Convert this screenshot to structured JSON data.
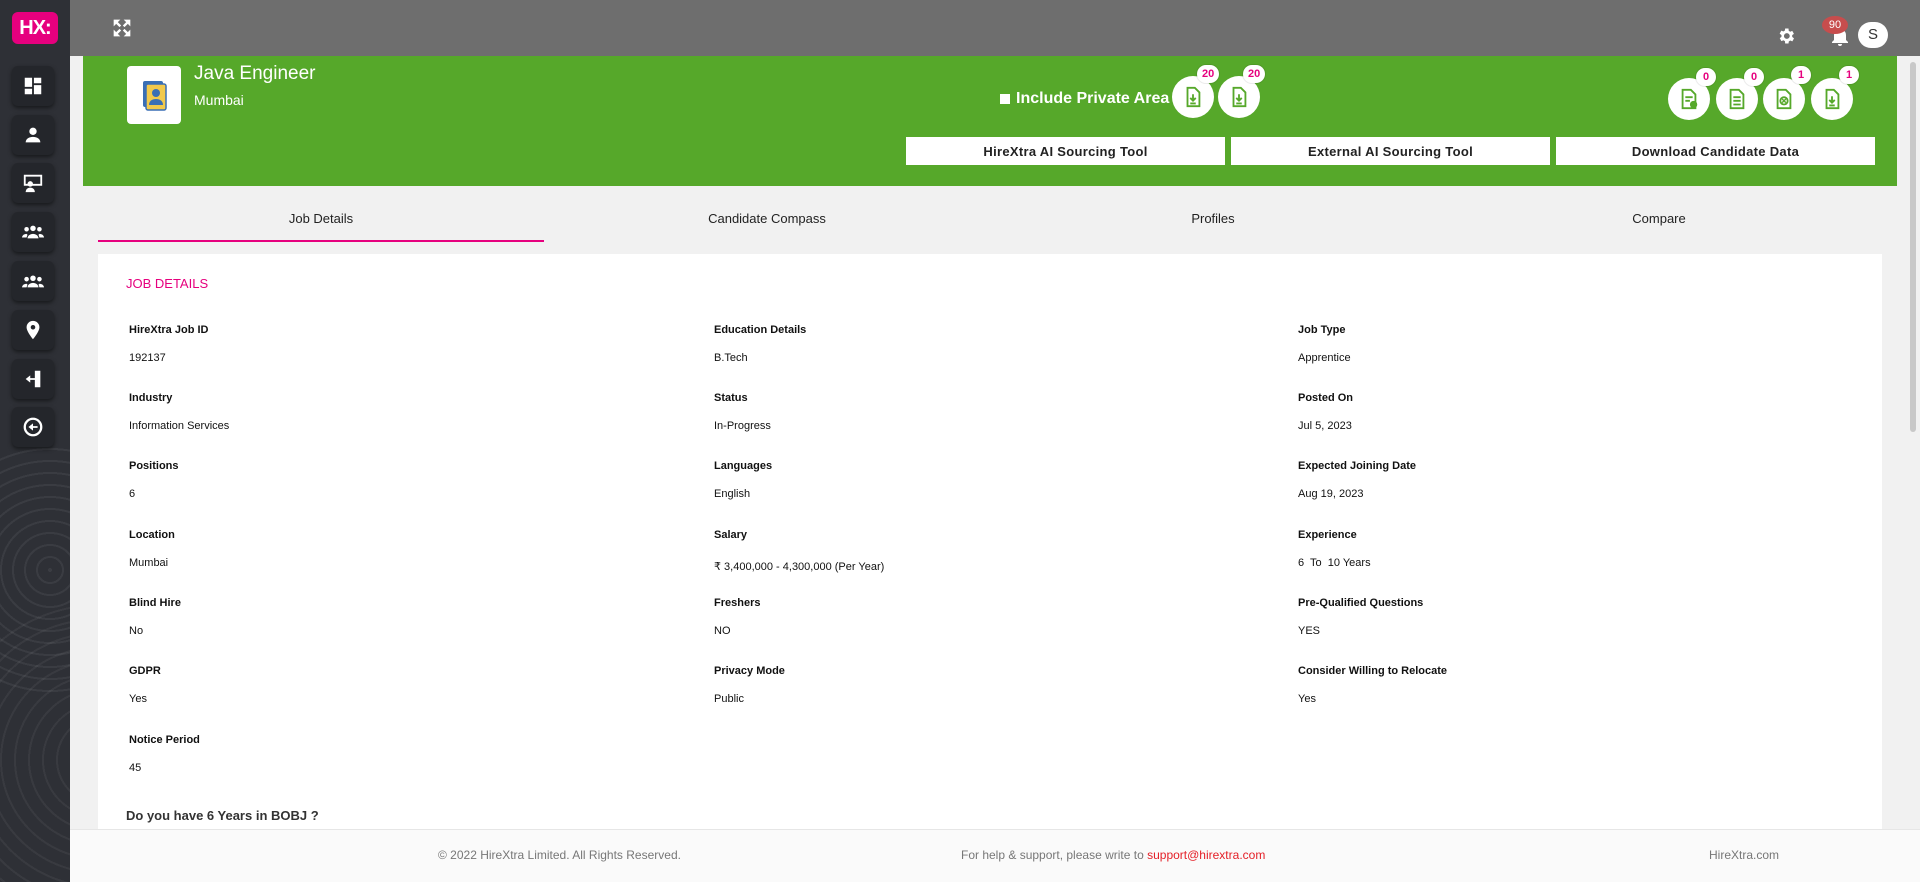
{
  "brand": {
    "logo_text": "HX:",
    "accent": "#e6007e",
    "green": "#56a82a"
  },
  "sidebar": {
    "items": [
      {
        "name": "dashboard-icon"
      },
      {
        "name": "user-icon"
      },
      {
        "name": "presentation-icon"
      },
      {
        "name": "team-icon"
      },
      {
        "name": "group-icon"
      },
      {
        "name": "location-pin-icon"
      },
      {
        "name": "logout-icon"
      },
      {
        "name": "back-arrow-icon"
      }
    ]
  },
  "topbar": {
    "notifications_count": "90",
    "avatar_initial": "S"
  },
  "job": {
    "title": "Java Engineer",
    "location": "Mumbai",
    "include_private_label": "Include Private Area",
    "left_badges": [
      "20",
      "20"
    ],
    "right_badges": [
      "0",
      "0",
      "1",
      "1"
    ],
    "buttons": [
      "HireXtra AI Sourcing Tool",
      "External AI Sourcing Tool",
      "Download Candidate Data"
    ]
  },
  "tabs": [
    "Job Details",
    "Candidate Compass",
    "Profiles",
    "Compare"
  ],
  "details": {
    "section_title": "JOB DETAILS",
    "rows": [
      [
        {
          "label": "HireXtra Job ID",
          "value": "192137"
        },
        {
          "label": "Education Details",
          "value": "B.Tech"
        },
        {
          "label": "Job Type",
          "value": "Apprentice"
        }
      ],
      [
        {
          "label": "Industry",
          "value": "Information Services"
        },
        {
          "label": "Status",
          "value": "In-Progress"
        },
        {
          "label": "Posted On",
          "value": "Jul 5, 2023"
        }
      ],
      [
        {
          "label": "Positions",
          "value": "6"
        },
        {
          "label": "Languages",
          "value": "English"
        },
        {
          "label": "Expected Joining Date",
          "value": "Aug 19, 2023"
        }
      ],
      [
        {
          "label": "Location",
          "value": "Mumbai"
        },
        {
          "label": "Salary",
          "value": "₹ 3,400,000 - 4,300,000 (Per Year)"
        },
        {
          "label": "Experience",
          "value": "6  To  10 Years"
        }
      ],
      [
        {
          "label": "Blind Hire",
          "value": "No"
        },
        {
          "label": "Freshers",
          "value": "NO"
        },
        {
          "label": "Pre-Qualified Questions",
          "value": "YES"
        }
      ],
      [
        {
          "label": "GDPR",
          "value": "Yes"
        },
        {
          "label": "Privacy Mode",
          "value": "Public"
        },
        {
          "label": "Consider Willing to Relocate",
          "value": "Yes"
        }
      ],
      [
        {
          "label": "Notice Period",
          "value": "45"
        }
      ]
    ],
    "question": "Do you have 6 Years in BOBJ ?"
  },
  "footer": {
    "copyright": "© 2022 HireXtra Limited. All Rights Reserved.",
    "help_text": "For help & support, please write to ",
    "help_email": "support@hirextra.com",
    "site": "HireXtra.com"
  }
}
